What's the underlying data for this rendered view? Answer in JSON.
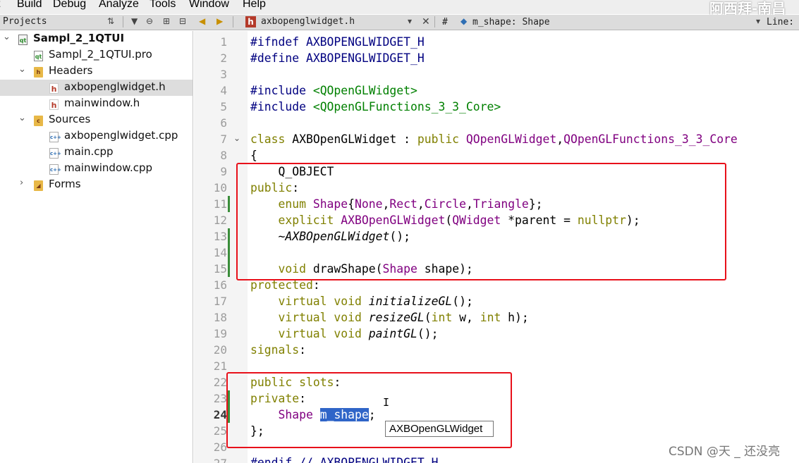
{
  "menu": [
    "t",
    "Build",
    "Debug",
    "Analyze",
    "Tools",
    "Window",
    "Help"
  ],
  "watermark_top": "阿西拜-南昌",
  "toolbar": {
    "pane_title": "Projects",
    "file_name": "axbopenglwidget.h",
    "hash": "#",
    "symbol": "m_shape: Shape",
    "line_label": "Line:"
  },
  "sidebar": {
    "items": [
      {
        "label": "Sampl_2_1QTUI",
        "icon": "project-icon",
        "arrow": "expanded"
      },
      {
        "label": "Sampl_2_1QTUI.pro",
        "icon": "pro-file-icon"
      },
      {
        "label": "Headers",
        "icon": "folder-icon",
        "arrow": "expanded"
      },
      {
        "label": "axbopenglwidget.h",
        "icon": "header-file-icon",
        "selected": true
      },
      {
        "label": "mainwindow.h",
        "icon": "header-file-icon"
      },
      {
        "label": "Sources",
        "icon": "folder-icon",
        "arrow": "expanded"
      },
      {
        "label": "axbopenglwidget.cpp",
        "icon": "cpp-file-icon"
      },
      {
        "label": "main.cpp",
        "icon": "cpp-file-icon"
      },
      {
        "label": "mainwindow.cpp",
        "icon": "cpp-file-icon"
      },
      {
        "label": "Forms",
        "icon": "folder-icon",
        "arrow": "collapsed"
      }
    ]
  },
  "editor": {
    "current_line": 24,
    "line_numbers": [
      "1",
      "2",
      "3",
      "4",
      "5",
      "6",
      "7",
      "8",
      "9",
      "10",
      "11",
      "12",
      "13",
      "14",
      "15",
      "16",
      "17",
      "18",
      "19",
      "20",
      "21",
      "22",
      "23",
      "24",
      "25",
      "26",
      "27"
    ],
    "code": {
      "l1a": "#ifndef",
      "l1b": " AXBOPENGLWIDGET_H",
      "l2a": "#define",
      "l2b": " AXBOPENGLWIDGET_H",
      "l4a": "#include",
      "l4b": " <QOpenGLWidget>",
      "l5a": "#include",
      "l5b": " <QOpenGLFunctions_3_3_Core>",
      "l7a": "class",
      "l7b": " AXBOpenGLWidget : ",
      "l7c": "public",
      "l7d": " QOpenGLWidget",
      "l7e": ",",
      "l7f": "QOpenGLFunctions_3_3_Core",
      "l8": "{",
      "l9": "    Q_OBJECT",
      "l10a": "public",
      "l10b": ":",
      "l11a": "    enum",
      "l11b": " Shape",
      "l11c": "{",
      "l11d": "None",
      "l11e": ",",
      "l11f": "Rect",
      "l11g": ",",
      "l11h": "Circle",
      "l11i": ",",
      "l11j": "Triangle",
      "l11k": "};",
      "l12a": "    explicit",
      "l12b": " AXBOpenGLWidget",
      "l12c": "(",
      "l12d": "QWidget",
      "l12e": " *parent = ",
      "l12f": "nullptr",
      "l12g": ");",
      "l13a": "    ",
      "l13b": "~AXBOpenGLWidget",
      "l13c": "();",
      "l15a": "    void",
      "l15b": " drawShape",
      "l15c": "(",
      "l15d": "Shape",
      "l15e": " shape);",
      "l16a": "protected",
      "l16b": ":",
      "l17a": "    virtual",
      "l17b": " void",
      "l17c": " ",
      "l17d": "initializeGL",
      "l17e": "();",
      "l18a": "    virtual",
      "l18b": " void",
      "l18c": " ",
      "l18d": "resizeGL",
      "l18e": "(",
      "l18f": "int",
      "l18g": " w, ",
      "l18h": "int",
      "l18i": " h);",
      "l19a": "    virtual",
      "l19b": " void",
      "l19c": " ",
      "l19d": "paintGL",
      "l19e": "();",
      "l20a": "signals",
      "l20b": ":",
      "l22a": "public",
      "l22b": " ",
      "l22c": "slots",
      "l22d": ":",
      "l23a": "private",
      "l23b": ":",
      "l24a": "    ",
      "l24b": "Shape",
      "l24c": " ",
      "l24d": "m_shape",
      "l24e": ";",
      "l25": "};",
      "l27a": "#endif",
      "l27b": " // AXBOPENGLWIDGET_H"
    }
  },
  "tooltip": "AXBOpenGLWidget",
  "ibeam": "I",
  "watermark_bottom": "CSDN @天 _ 还没亮",
  "colors": {
    "annotation_box": "#e8101a",
    "selection": "#2f65c8",
    "keyword": "#808000",
    "type": "#800080",
    "preprocessor": "#000080"
  }
}
